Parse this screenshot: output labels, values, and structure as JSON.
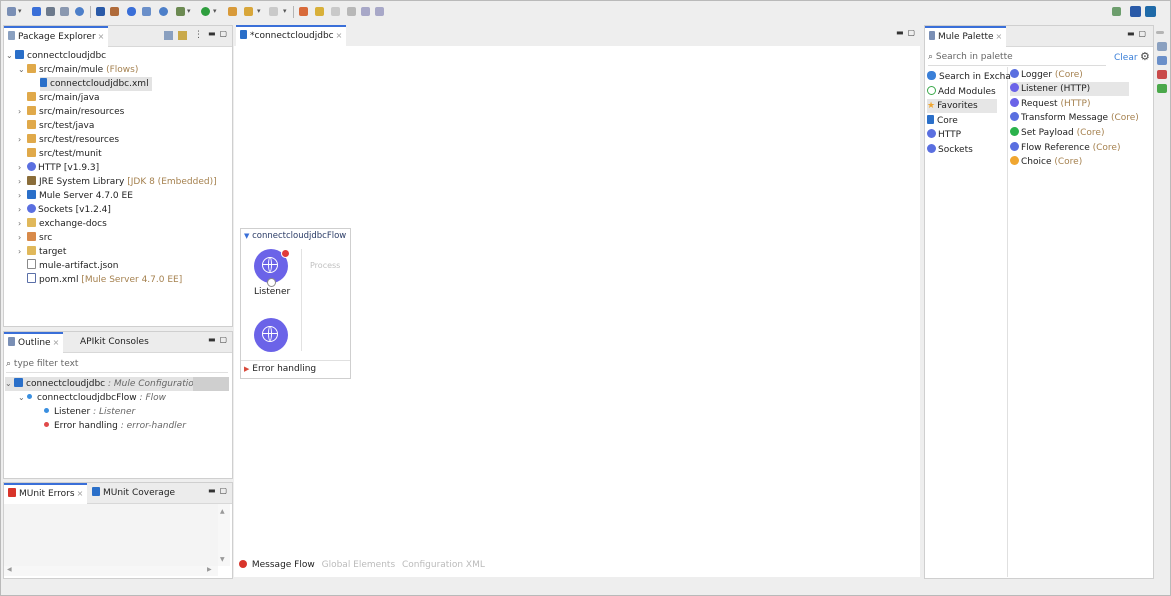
{
  "editor_tab": "*connectcloudjdbc",
  "package_explorer": {
    "tab": "Package Explorer",
    "rows": [
      {
        "name": "connectcloudjdbc",
        "deco": ""
      },
      {
        "name": "src/main/mule",
        "deco": "(Flows)"
      },
      {
        "name": "connectcloudjdbc.xml",
        "deco": ""
      },
      {
        "name": "src/main/java",
        "deco": ""
      },
      {
        "name": "src/main/resources",
        "deco": ""
      },
      {
        "name": "src/test/java",
        "deco": ""
      },
      {
        "name": "src/test/resources",
        "deco": ""
      },
      {
        "name": "src/test/munit",
        "deco": ""
      },
      {
        "name": "HTTP [v1.9.3]",
        "deco": ""
      },
      {
        "name": "JRE System Library",
        "deco": "[JDK 8 (Embedded)]"
      },
      {
        "name": "Mule Server 4.7.0 EE",
        "deco": ""
      },
      {
        "name": "Sockets [v1.2.4]",
        "deco": ""
      },
      {
        "name": "exchange-docs",
        "deco": ""
      },
      {
        "name": "src",
        "deco": ""
      },
      {
        "name": "target",
        "deco": ""
      },
      {
        "name": "mule-artifact.json",
        "deco": ""
      },
      {
        "name": "pom.xml",
        "deco": "[Mule Server 4.7.0 EE]"
      }
    ]
  },
  "outline": {
    "tab": "Outline",
    "tab2": "APIkit Consoles",
    "filter_placeholder": "type filter text",
    "root": {
      "name": "connectcloudjdbc",
      "type": ": Mule Configuration"
    },
    "flow": {
      "name": "connectcloudjdbcFlow",
      "type": ": Flow"
    },
    "listener": {
      "name": "Listener",
      "type": ": Listener"
    },
    "error": {
      "name": "Error handling",
      "type": ": error-handler"
    }
  },
  "munit": {
    "tab": "MUnit Errors",
    "tab2": "MUnit Coverage"
  },
  "canvas": {
    "flow_name": "connectcloudjdbcFlow",
    "source_label": "Listener",
    "process_label": "Process",
    "error_handling": "Error handling",
    "bottom_tabs": [
      "Message Flow",
      "Global Elements",
      "Configuration XML"
    ]
  },
  "palette": {
    "tab": "Mule Palette",
    "search_placeholder": "Search in palette",
    "clear": "Clear",
    "modules": [
      "Search in Excha",
      "Add Modules",
      "Favorites",
      "Core",
      "HTTP",
      "Sockets"
    ],
    "items": [
      {
        "name": "Logger",
        "suffix": "(Core)",
        "color": "#5a6fe0"
      },
      {
        "name": "Listener",
        "suffix": "(HTTP)",
        "color": "#6b63e8"
      },
      {
        "name": "Request",
        "suffix": "(HTTP)",
        "color": "#6b63e8"
      },
      {
        "name": "Transform Message",
        "suffix": "(Core)",
        "color": "#5a6fe0"
      },
      {
        "name": "Set Payload",
        "suffix": "(Core)",
        "color": "#2bb24c"
      },
      {
        "name": "Flow Reference",
        "suffix": "(Core)",
        "color": "#5a6fe0"
      },
      {
        "name": "Choice",
        "suffix": "(Core)",
        "color": "#f0a630"
      }
    ]
  }
}
